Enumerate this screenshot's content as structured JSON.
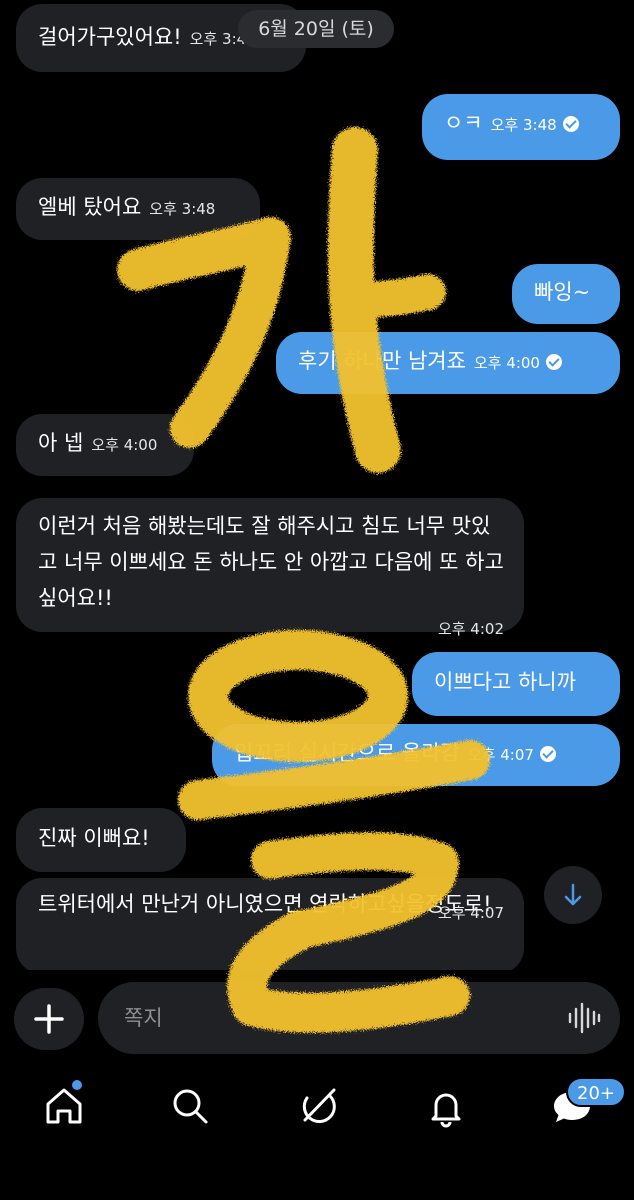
{
  "date_divider": "6월 20일 (토)",
  "messages": [
    {
      "side": "in",
      "text": "걸어가구있어요!",
      "time": "오후 3:46"
    },
    {
      "side": "out",
      "text": "ㅇㅋ",
      "time": "오후 3:48",
      "read": true
    },
    {
      "side": "in",
      "text": "엘베 탔어요",
      "time": "오후 3:48"
    },
    {
      "side": "out",
      "text": "빠잉~",
      "time": ""
    },
    {
      "side": "out",
      "text": "후기 하나만 남겨죠",
      "time": "오후 4:00",
      "read": true
    },
    {
      "side": "in",
      "text": "아 넵",
      "time": "오후 4:00"
    },
    {
      "side": "in",
      "text": "이런거 처음 해봤는데도 잘 해주시고 침도 너무 맛있고 너무 이쁘세요 돈 하나도 안 아깝고 다음에 또 하고싶어요!!",
      "time": "오후 4:02"
    },
    {
      "side": "out",
      "text": "이쁘다고 하니까",
      "time": ""
    },
    {
      "side": "out",
      "text": "입꼬리 실시간으로 올라감",
      "time": "오후 4:07",
      "read": true
    },
    {
      "side": "in",
      "text": "진짜 이뻐요!",
      "time": ""
    },
    {
      "side": "in",
      "text": "트위터에서 만난거 아니였으면 연락하고싶을정도로!",
      "time": "오후 4:07"
    }
  ],
  "composer": {
    "placeholder": "쪽지"
  },
  "nav": {
    "home": "home-icon",
    "search": "search-icon",
    "grok": "grok-icon",
    "notifications": "bell-icon",
    "messages": "messages-icon",
    "messages_badge": "20+"
  },
  "overlay_text": [
    "가",
    "을"
  ],
  "colors": {
    "accent": "#4a9ae8",
    "incoming": "#1f2125",
    "background": "#000000",
    "overlay": "#f3c22d"
  }
}
